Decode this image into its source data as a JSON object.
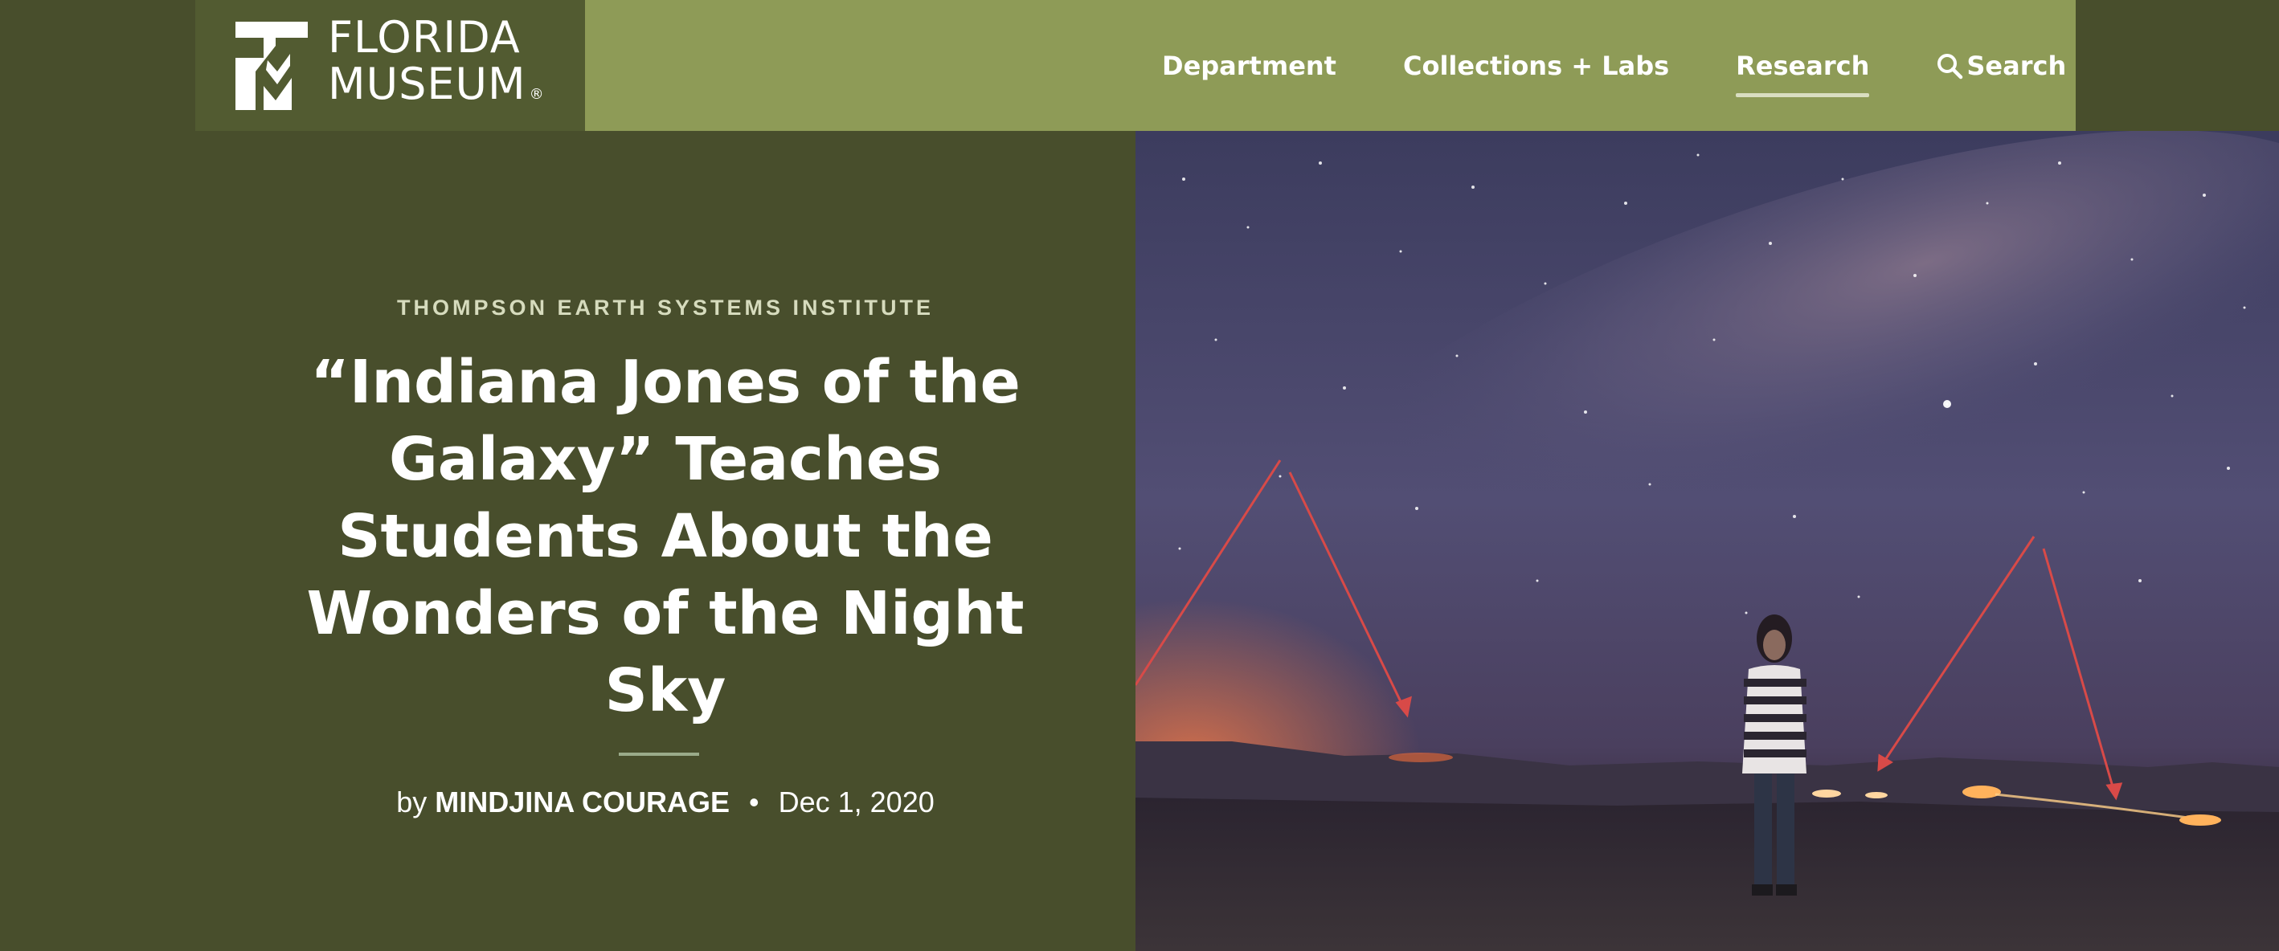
{
  "logo": {
    "line1": "FLORIDA",
    "line2": "MUSEUM",
    "registered": "®"
  },
  "nav": {
    "items": [
      {
        "label": "Department"
      },
      {
        "label": "Collections + Labs"
      },
      {
        "label": "Research",
        "active": true
      },
      {
        "label": "Search",
        "icon": "search-icon"
      }
    ]
  },
  "article": {
    "kicker": "THOMPSON EARTH SYSTEMS INSTITUTE",
    "title": "“Indiana Jones of the Galaxy” Teaches Students About the Wonders of the Night Sky",
    "byline_prefix": "by",
    "author": "MINDJINA COURAGE",
    "separator": "•",
    "date": "Dec 1, 2020"
  },
  "colors": {
    "header_bg": "#8e9b57",
    "logo_bg": "#525b31",
    "hero_bg": "#484e2c",
    "kicker": "#d6dbbd",
    "divider": "#9aab8a"
  },
  "photo": {
    "subject": "person-standing-under-night-sky",
    "icons": [
      "laser-arrow-icon"
    ]
  }
}
